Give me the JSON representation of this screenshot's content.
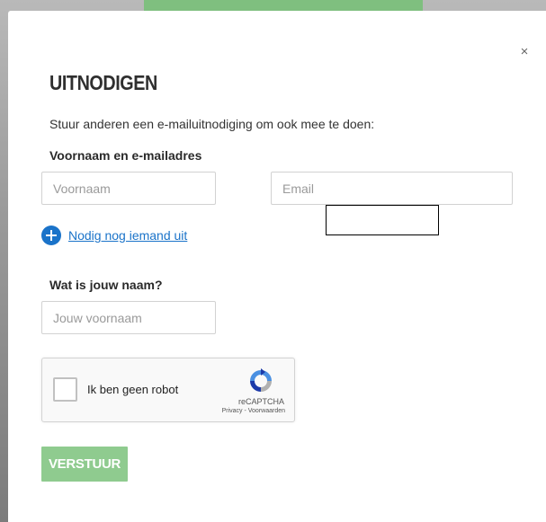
{
  "modal": {
    "close_label": "×",
    "title": "UITNODIGEN",
    "subtitle": "Stuur anderen een e-mailuitnodiging om ook mee te doen:"
  },
  "invite": {
    "section_label": "Voornaam en e-mailadres",
    "first_name_placeholder": "Voornaam",
    "first_name_value": "",
    "email_placeholder": "Email",
    "email_value": "",
    "add_another_label": "Nodig nog iemand uit"
  },
  "sender": {
    "section_label": "Wat is jouw naam?",
    "name_placeholder": "Jouw voornaam",
    "name_value": ""
  },
  "captcha": {
    "label": "Ik ben geen robot",
    "brand": "reCAPTCHA",
    "links": "Privacy - Voorwaarden",
    "checked": false
  },
  "submit_label": "VERSTUUR",
  "colors": {
    "accent_green": "#8fcb8f",
    "link_blue": "#1a73c9",
    "text_dark": "#2f2f2f"
  },
  "icons": {
    "close": "close-icon",
    "add": "plus-circle-icon",
    "captcha": "recaptcha-logo-icon"
  }
}
